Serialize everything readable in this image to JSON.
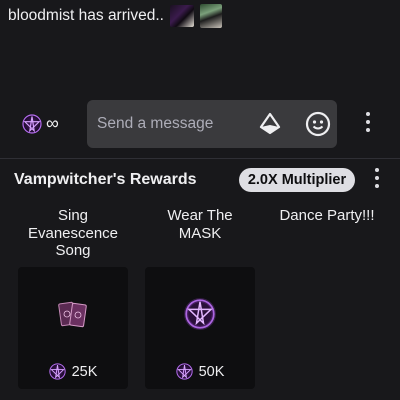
{
  "chat": {
    "message": "bloodmist has arrived.."
  },
  "input": {
    "points_value": "∞",
    "placeholder": "Send a message"
  },
  "rewards": {
    "title": "Vampwitcher's Rewards",
    "multiplier": "2.0X Multiplier",
    "items": [
      {
        "title": "Sing Evanescence Song",
        "cost": "25K"
      },
      {
        "title": "Wear The MASK",
        "cost": "50K"
      },
      {
        "title": "Dance Party!!!",
        "cost": ""
      }
    ]
  },
  "colors": {
    "background": "#18181b",
    "input_bg": "#3a3a3d",
    "badge_bg": "#dedee3",
    "card_bg": "#0e0e10",
    "pentagram": "#b56cf0"
  }
}
